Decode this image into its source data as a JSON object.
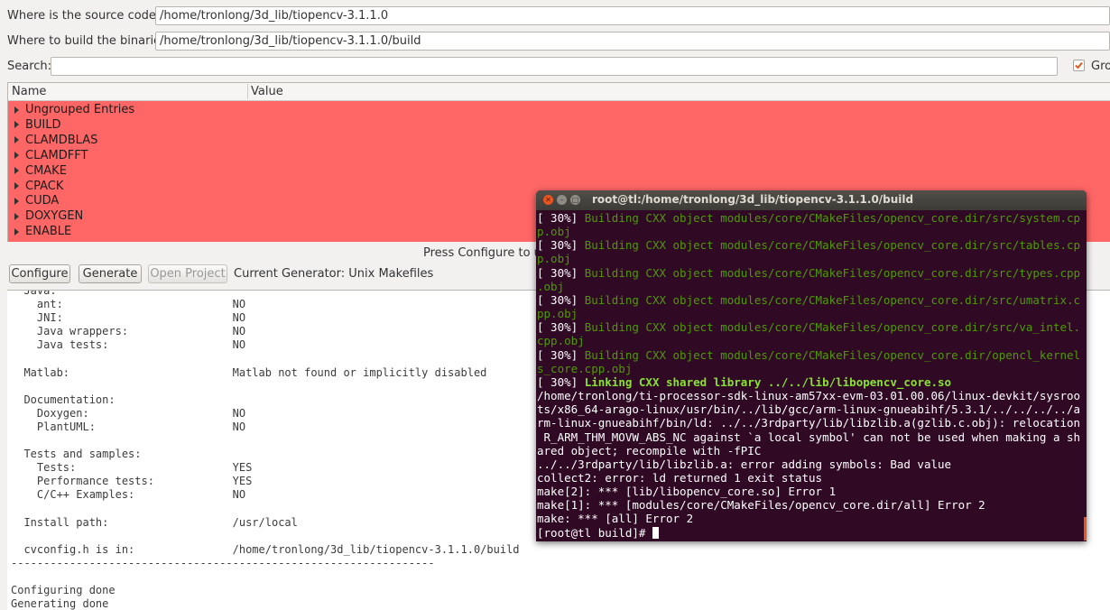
{
  "paths": {
    "source_label": "Where is the source code:",
    "source_value": "/home/tronlong/3d_lib/tiopencv-3.1.1.0",
    "build_label": "Where to build the binaries:",
    "build_value": "/home/tronlong/3d_lib/tiopencv-3.1.1.0/build"
  },
  "search": {
    "label": "Search:",
    "value": "",
    "grouped_label": "Gro",
    "grouped_checked": true
  },
  "table": {
    "col_name": "Name",
    "col_value": "Value",
    "entries": [
      "Ungrouped Entries",
      "BUILD",
      "CLAMDBLAS",
      "CLAMDFFT",
      "CMAKE",
      "CPACK",
      "CUDA",
      "DOXYGEN",
      "ENABLE"
    ],
    "highlight_color": "#ff6666"
  },
  "status": "Press Configure to up",
  "toolbar": {
    "configure": "Configure",
    "generate": "Generate",
    "open_project": "Open Project",
    "generator": "Current Generator: Unix Makefiles"
  },
  "log_lines": [
    "  Java:",
    "    ant:                          NO",
    "    JNI:                          NO",
    "    Java wrappers:                NO",
    "    Java tests:                   NO",
    "",
    "  Matlab:                         Matlab not found or implicitly disabled",
    "",
    "  Documentation:",
    "    Doxygen:                      NO",
    "    PlantUML:                     NO",
    "",
    "  Tests and samples:",
    "    Tests:                        YES",
    "    Performance tests:            YES",
    "    C/C++ Examples:               NO",
    "",
    "  Install path:                   /usr/local",
    "",
    "  cvconfig.h is in:               /home/tronlong/3d_lib/tiopencv-3.1.1.0/build",
    "-----------------------------------------------------------------",
    "",
    "Configuring done",
    "Generating done"
  ],
  "terminal": {
    "title": "root@tl:/home/tronlong/3d_lib/tiopencv-3.1.1.0/build",
    "lines": [
      {
        "prefix": "[ 30%] ",
        "text": "Building CXX object modules/core/CMakeFiles/opencv_core.dir/src/system.cp",
        "style": "g"
      },
      {
        "prefix": "",
        "text": "p.obj",
        "style": "g"
      },
      {
        "prefix": "[ 30%] ",
        "text": "Building CXX object modules/core/CMakeFiles/opencv_core.dir/src/tables.cp",
        "style": "g"
      },
      {
        "prefix": "",
        "text": "p.obj",
        "style": "g"
      },
      {
        "prefix": "[ 30%] ",
        "text": "Building CXX object modules/core/CMakeFiles/opencv_core.dir/src/types.cpp",
        "style": "g"
      },
      {
        "prefix": "",
        "text": ".obj",
        "style": "g"
      },
      {
        "prefix": "[ 30%] ",
        "text": "Building CXX object modules/core/CMakeFiles/opencv_core.dir/src/umatrix.c",
        "style": "g"
      },
      {
        "prefix": "",
        "text": "pp.obj",
        "style": "g"
      },
      {
        "prefix": "[ 30%] ",
        "text": "Building CXX object modules/core/CMakeFiles/opencv_core.dir/src/va_intel.",
        "style": "g"
      },
      {
        "prefix": "",
        "text": "cpp.obj",
        "style": "g"
      },
      {
        "prefix": "[ 30%] ",
        "text": "Building CXX object modules/core/CMakeFiles/opencv_core.dir/opencl_kernel",
        "style": "g"
      },
      {
        "prefix": "",
        "text": "s_core.cpp.obj",
        "style": "g"
      },
      {
        "prefix": "[ 30%] ",
        "text": "Linking CXX shared library ../../lib/libopencv_core.so",
        "style": "gb"
      },
      {
        "prefix": "",
        "text": "/home/tronlong/ti-processor-sdk-linux-am57xx-evm-03.01.00.06/linux-devkit/sysroo",
        "style": ""
      },
      {
        "prefix": "",
        "text": "ts/x86_64-arago-linux/usr/bin/../lib/gcc/arm-linux-gnueabihf/5.3.1/../../../../a",
        "style": ""
      },
      {
        "prefix": "",
        "text": "rm-linux-gnueabihf/bin/ld: ../../3rdparty/lib/libzlib.a(gzlib.c.obj): relocation",
        "style": ""
      },
      {
        "prefix": "",
        "text": " R_ARM_THM_MOVW_ABS_NC against `a local symbol' can not be used when making a sh",
        "style": ""
      },
      {
        "prefix": "",
        "text": "ared object; recompile with -fPIC",
        "style": ""
      },
      {
        "prefix": "",
        "text": "../../3rdparty/lib/libzlib.a: error adding symbols: Bad value",
        "style": ""
      },
      {
        "prefix": "",
        "text": "collect2: error: ld returned 1 exit status",
        "style": ""
      },
      {
        "prefix": "",
        "text": "make[2]: *** [lib/libopencv_core.so] Error 1",
        "style": ""
      },
      {
        "prefix": "",
        "text": "make[1]: *** [modules/core/CMakeFiles/opencv_core.dir/all] Error 2",
        "style": ""
      },
      {
        "prefix": "",
        "text": "make: *** [all] Error 2",
        "style": ""
      },
      {
        "prefix": "",
        "text": "[root@tl build]# ",
        "style": "prompt"
      }
    ]
  }
}
